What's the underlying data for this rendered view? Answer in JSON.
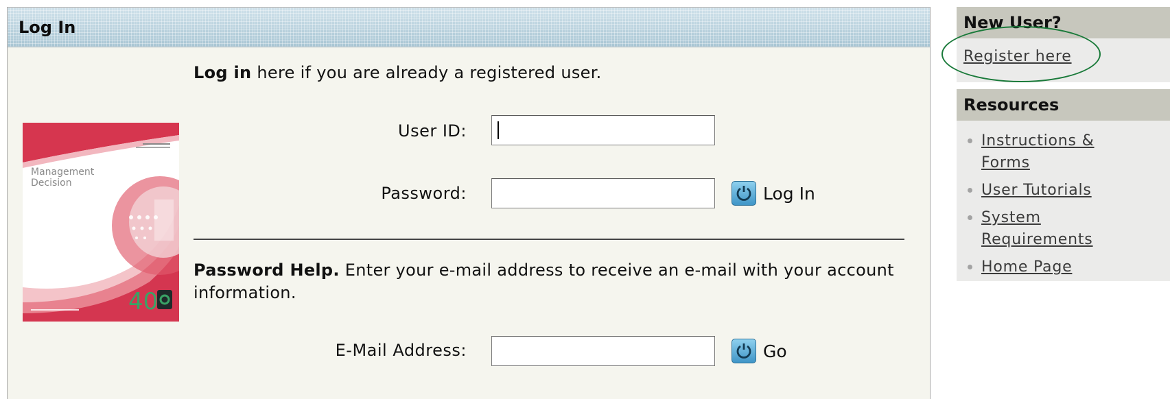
{
  "login": {
    "header": "Log In",
    "intro_bold": "Log in",
    "intro_rest": " here if you are already a registered user.",
    "user_id_label": "User ID:",
    "user_id_value": "",
    "password_label": "Password:",
    "password_value": "",
    "login_button": "Log In",
    "help_bold": "Password Help.",
    "help_rest": " Enter your e-mail address to receive an e-mail with your account information.",
    "email_label": "E-Mail Address:",
    "email_value": "",
    "go_button": "Go"
  },
  "cover": {
    "title_line1": "Management",
    "title_line2": "Decision",
    "badge": "40"
  },
  "sidebar": {
    "new_user_heading": "New User?",
    "register_link": "Register here",
    "resources_heading": "Resources",
    "resources": [
      {
        "label": "Instructions & Forms"
      },
      {
        "label": "User Tutorials"
      },
      {
        "label": "System Requirements"
      },
      {
        "label": "Home Page"
      }
    ]
  },
  "colors": {
    "header_blue": "#b5cfdc",
    "panel_bg": "#f5f5ee",
    "sidebar_head": "#c7c7bd",
    "annotation_oval": "#1a7a3a"
  },
  "icons": [
    "refresh-go-icon",
    "bullet-icon"
  ]
}
